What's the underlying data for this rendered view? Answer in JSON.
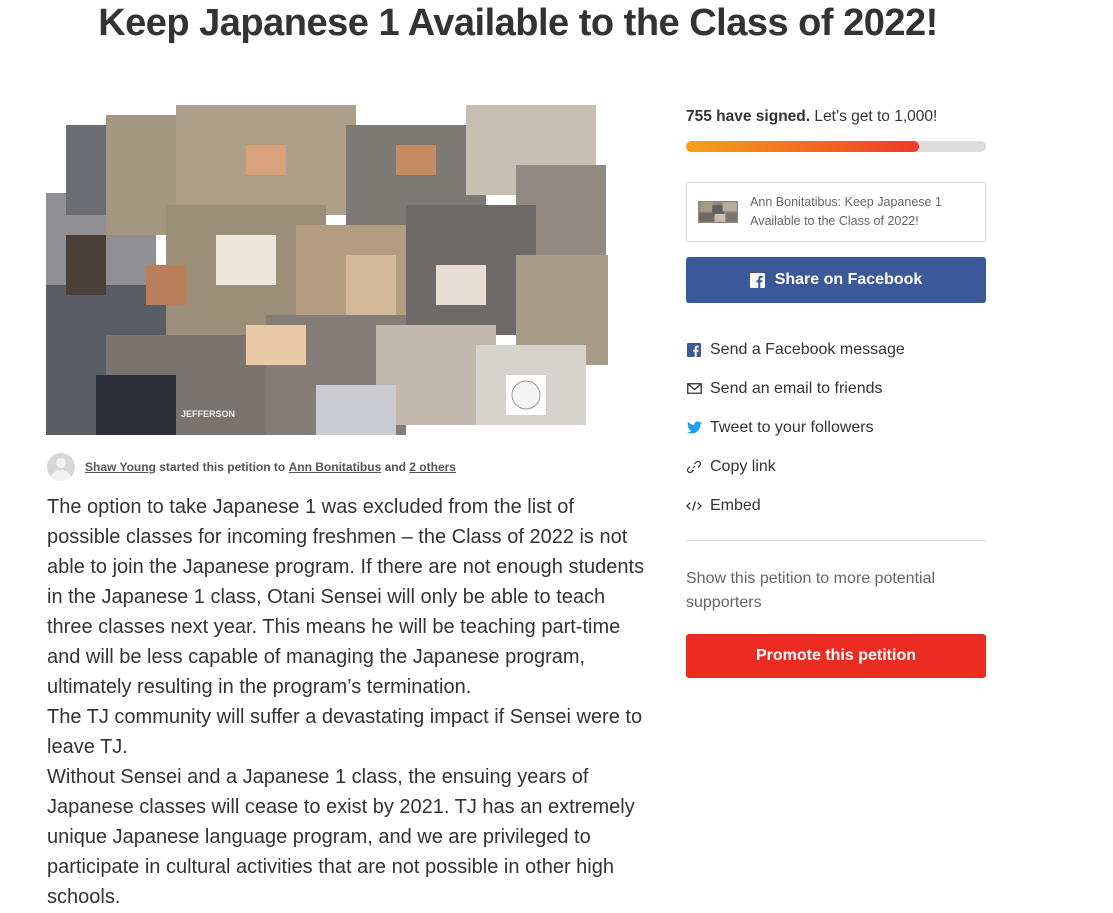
{
  "page": {
    "title": "Keep Japanese 1 Available to the Class of 2022!"
  },
  "hero": {
    "description": "collage of students in a Japanese classroom",
    "visible_text": [
      "JEFFERSON"
    ]
  },
  "author": {
    "name": "Shaw Young",
    "mid_text": "started this petition to",
    "recipient": "Ann Bonitatibus",
    "and_text": "and",
    "others": "2 others"
  },
  "body": {
    "paragraphs": [
      "The option to take Japanese 1 was excluded from the list of possible classes for incoming freshmen – the Class of 2022 is not able to join the Japanese program. If there are not enough students in the Japanese 1 class, Otani Sensei will only be able to teach three classes next year. This means he will be teaching part-time and will be less capable of managing the Japanese program, ultimately resulting in the program’s termination.",
      "The TJ community will suffer a devastating impact if Sensei were to leave TJ.",
      "Without Sensei and a Japanese 1 class, the ensuing years of Japanese classes will cease to exist by 2021. TJ has an extremely unique Japanese language program, and we are privileged to participate in cultural activities that are not possible in other high schools."
    ]
  },
  "signatures": {
    "count_text": "755 have signed.",
    "goal_text": "Let’s get to 1,000!",
    "count": 755,
    "goal": 1000,
    "progress_fraction": 0.775
  },
  "preview_card": {
    "text": "Ann Bonitatibus: Keep Japanese 1 Available to the Class of 2022!"
  },
  "share": {
    "facebook_button": "Share on Facebook",
    "items": [
      {
        "label": "Send a Facebook message",
        "icon": "facebook-square-icon"
      },
      {
        "label": "Send an email to friends",
        "icon": "envelope-icon"
      },
      {
        "label": "Tweet to your followers",
        "icon": "twitter-bird-icon"
      },
      {
        "label": "Copy link",
        "icon": "link-icon"
      },
      {
        "label": "Embed",
        "icon": "code-icon"
      }
    ]
  },
  "promote": {
    "hint": "Show this petition to more potential supporters",
    "button": "Promote this petition"
  },
  "colors": {
    "facebook_blue": "#3b5998",
    "promote_red": "#ec2c22",
    "progress_start": "#f7a21b",
    "progress_end": "#ee3b24",
    "twitter_blue": "#1da1f2"
  }
}
